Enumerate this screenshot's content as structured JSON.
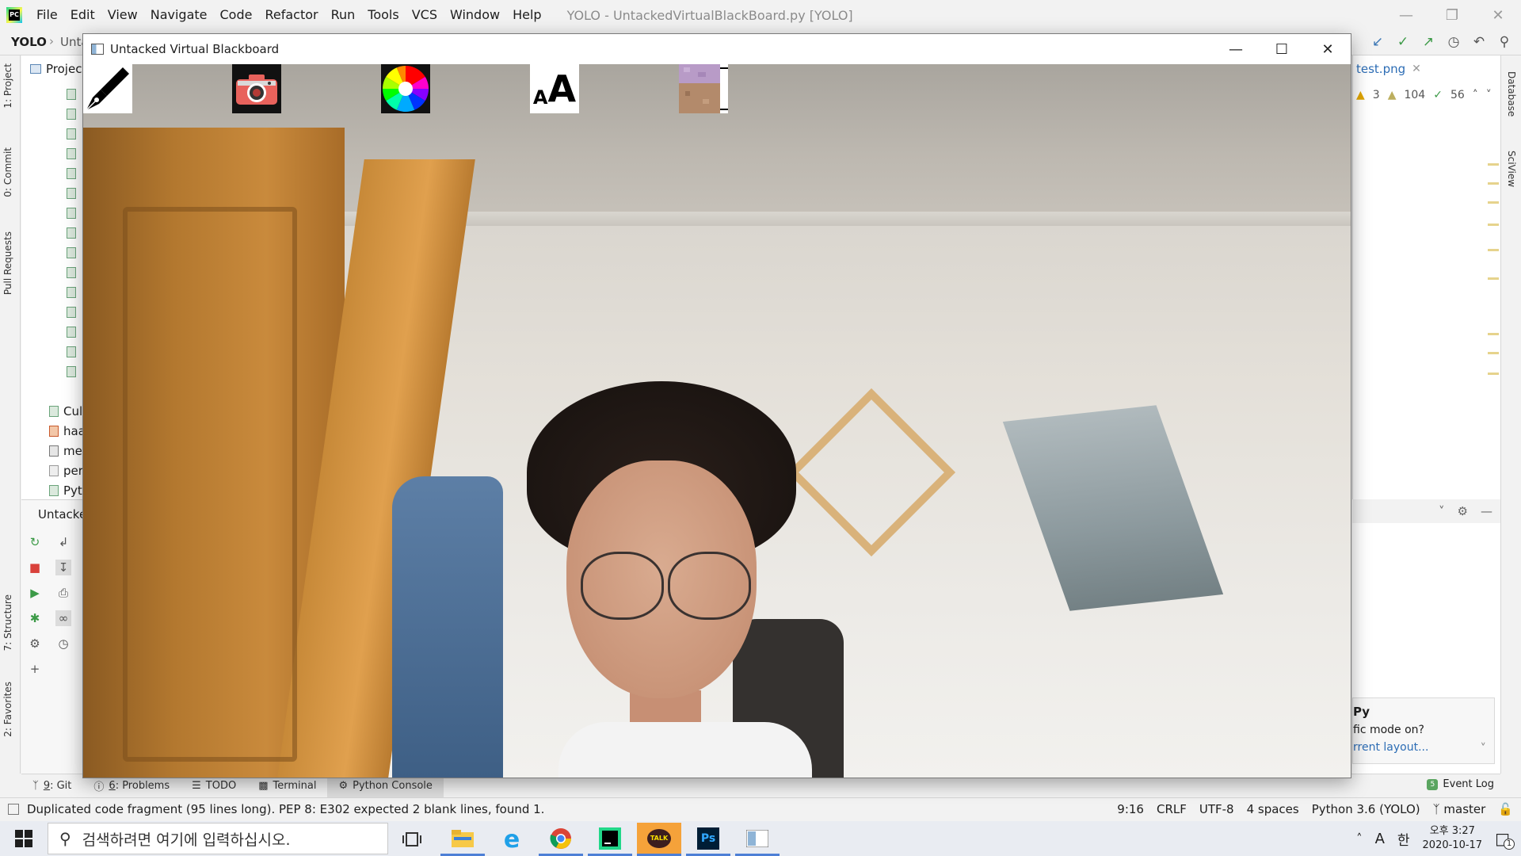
{
  "ide": {
    "menu": [
      "File",
      "Edit",
      "View",
      "Navigate",
      "Code",
      "Refactor",
      "Run",
      "Tools",
      "VCS",
      "Window",
      "Help"
    ],
    "window_title": "YOLO - UntackedVirtualBlackBoard.py [YOLO]",
    "nav": {
      "project": "YOLO",
      "file_partial": "Unta"
    },
    "project_tab": "Projec",
    "tree_rows": [
      "Cul",
      "haa",
      "me",
      "per",
      "Pyt"
    ],
    "run_tab": "Untacke",
    "left_tabs": [
      "1: Project",
      "0: Commit",
      "Pull Requests",
      "7: Structure",
      "2: Favorites"
    ],
    "right_tabs": [
      "Database",
      "SciView"
    ],
    "editor_tab": "test.png",
    "inspections": {
      "warnings": "3",
      "weak_warnings": "104",
      "typos": "56"
    },
    "balloon": {
      "title": "Py",
      "message": "fic mode on?",
      "link": "rrent layout..."
    },
    "tool_tabs": [
      {
        "num": "9",
        "label": ": Git"
      },
      {
        "num": "6",
        "label": ": Problems"
      },
      {
        "num": "",
        "label": "TODO"
      },
      {
        "num": "",
        "label": "Terminal"
      },
      {
        "num": "",
        "label": "Python Console"
      }
    ],
    "event_log": "Event Log",
    "event_badge": "5",
    "status": {
      "message": "Duplicated code fragment (95 lines long). PEP 8: E302 expected 2 blank lines, found 1.",
      "position": "9:16",
      "line_sep": "CRLF",
      "encoding": "UTF-8",
      "indent": "4 spaces",
      "interpreter": "Python 3.6 (YOLO)",
      "branch": "master"
    }
  },
  "cv_window": {
    "title": "Untacked Virtual Blackboard",
    "tools": [
      {
        "name": "pen-tool",
        "icon": "fountain-pen-icon"
      },
      {
        "name": "camera-tool",
        "icon": "camera-icon"
      },
      {
        "name": "color-tool",
        "icon": "color-wheel-icon"
      },
      {
        "name": "text-tool",
        "icon": "text-size-icon",
        "small": "A",
        "large": "A"
      },
      {
        "name": "eraser-tool",
        "icon": "eraser-icon"
      }
    ]
  },
  "taskbar": {
    "search_placeholder": "검색하려면 여기에 입력하십시오.",
    "apps": [
      "task-view-icon",
      "file-explorer-icon",
      "internet-explorer-icon",
      "chrome-icon",
      "pycharm-icon",
      "kakaotalk-icon",
      "photoshop-icon",
      "opencv-window-icon"
    ],
    "kakao_label": "TALK",
    "ps_label": "Ps",
    "ime_label": "A",
    "ime_lang": "한",
    "time": "오후 3:27",
    "date": "2020-10-17",
    "notif_count": "1"
  },
  "colors": {
    "accent": "#2d6db5",
    "tab_active": "#dcdcdc",
    "kakao_yellow": "#f9e000",
    "ps_blue": "#001e36"
  }
}
